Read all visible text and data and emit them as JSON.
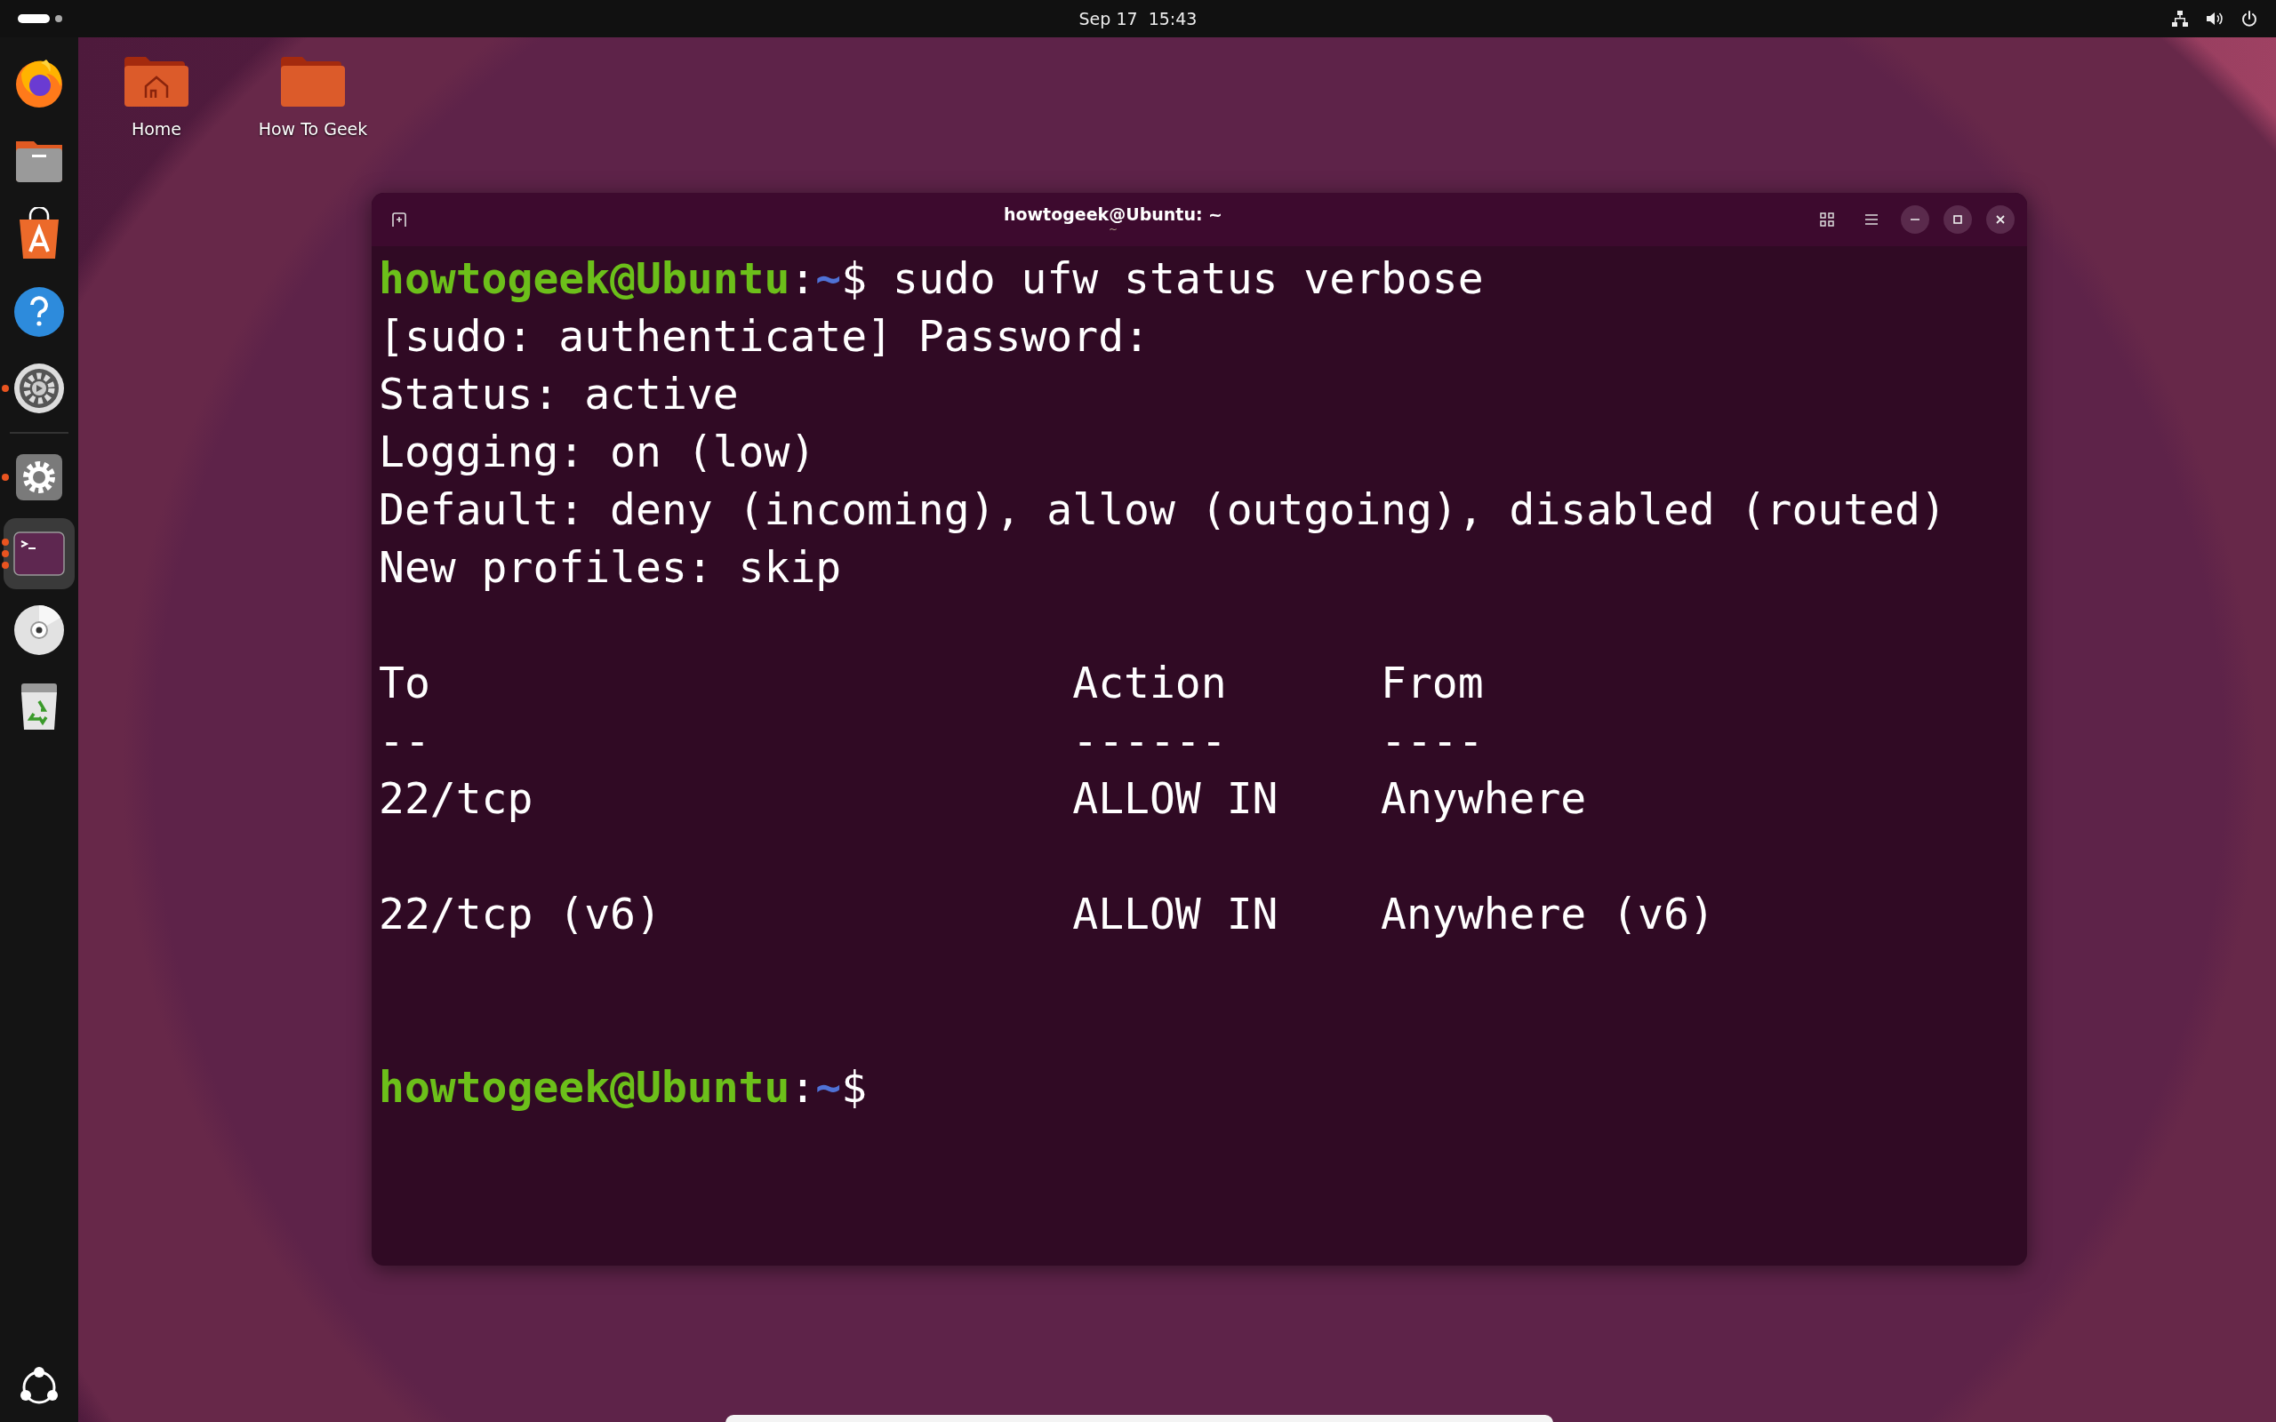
{
  "top_bar": {
    "clock": "Sep 17  15:43"
  },
  "dock": {
    "groups": [
      {
        "items": [
          {
            "kind": "browser",
            "running": false,
            "active": false
          },
          {
            "kind": "files",
            "running": false,
            "active": false
          },
          {
            "kind": "store",
            "running": false,
            "active": false
          },
          {
            "kind": "help",
            "running": false,
            "active": false
          },
          {
            "kind": "disks",
            "running": true,
            "multiple_windows": false,
            "active": false
          }
        ]
      },
      {
        "items": [
          {
            "kind": "settings",
            "running": true,
            "multiple_windows": false,
            "active": false
          },
          {
            "kind": "terminal",
            "running": true,
            "multiple_windows": true,
            "active": true
          },
          {
            "kind": "disc",
            "running": false,
            "active": false
          },
          {
            "kind": "trash",
            "running": false,
            "active": false
          }
        ]
      }
    ]
  },
  "desktop_icons": [
    {
      "label": "Home",
      "kind": "home"
    },
    {
      "label": "How To Geek",
      "kind": "folder"
    }
  ],
  "terminal": {
    "title": "howtogeek@Ubuntu: ~",
    "subtitle": "~",
    "lines": [
      {
        "kind": "prompt",
        "user": "howtogeek@Ubuntu",
        "sep": ":",
        "path": "~",
        "symbol": "$",
        "command": " sudo ufw status verbose"
      },
      {
        "kind": "output",
        "text": "[sudo: authenticate] Password:"
      },
      {
        "kind": "output",
        "text": "Status: active"
      },
      {
        "kind": "output",
        "text": "Logging: on (low)"
      },
      {
        "kind": "output",
        "text": "Default: deny (incoming), allow (outgoing), disabled (routed)"
      },
      {
        "kind": "output",
        "text": "New profiles: skip"
      },
      {
        "kind": "blank"
      },
      {
        "kind": "row",
        "cells": [
          "To",
          "Action",
          "From"
        ]
      },
      {
        "kind": "row",
        "cells": [
          "--",
          "------",
          "----"
        ]
      },
      {
        "kind": "row",
        "cells": [
          "22/tcp",
          "ALLOW IN",
          "Anywhere"
        ]
      },
      {
        "kind": "blank"
      },
      {
        "kind": "row",
        "cells": [
          "22/tcp (v6)",
          "ALLOW IN",
          "Anywhere (v6)"
        ]
      },
      {
        "kind": "blank"
      },
      {
        "kind": "blank"
      },
      {
        "kind": "prompt",
        "user": "howtogeek@Ubuntu",
        "sep": ":",
        "path": "~",
        "symbol": "$"
      }
    ]
  }
}
